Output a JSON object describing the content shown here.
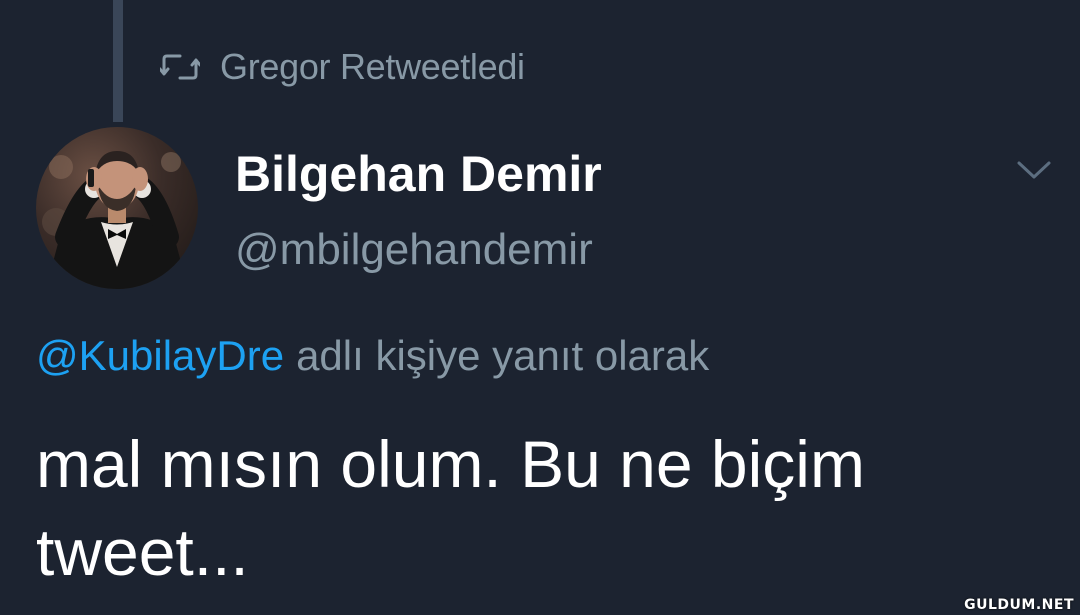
{
  "retweet": {
    "icon": "retweet-icon",
    "label": "Gregor Retweetledi"
  },
  "author": {
    "display_name": "Bilgehan Demir",
    "handle": "@mbilgehandemir",
    "avatar_icon": "avatar-photo"
  },
  "menu": {
    "icon": "chevron-down-icon"
  },
  "reply": {
    "mention": "@KubilayDre",
    "suffix": "adlı kişiye yanıt olarak"
  },
  "tweet": {
    "text": "mal mısın olum. Bu ne biçim tweet..."
  },
  "watermark": "GULDUM.NET",
  "colors": {
    "background": "#1c2330",
    "primary_text": "#ffffff",
    "secondary_text": "#8899a6",
    "link": "#1da1f2",
    "thread_line": "#3a4658"
  }
}
